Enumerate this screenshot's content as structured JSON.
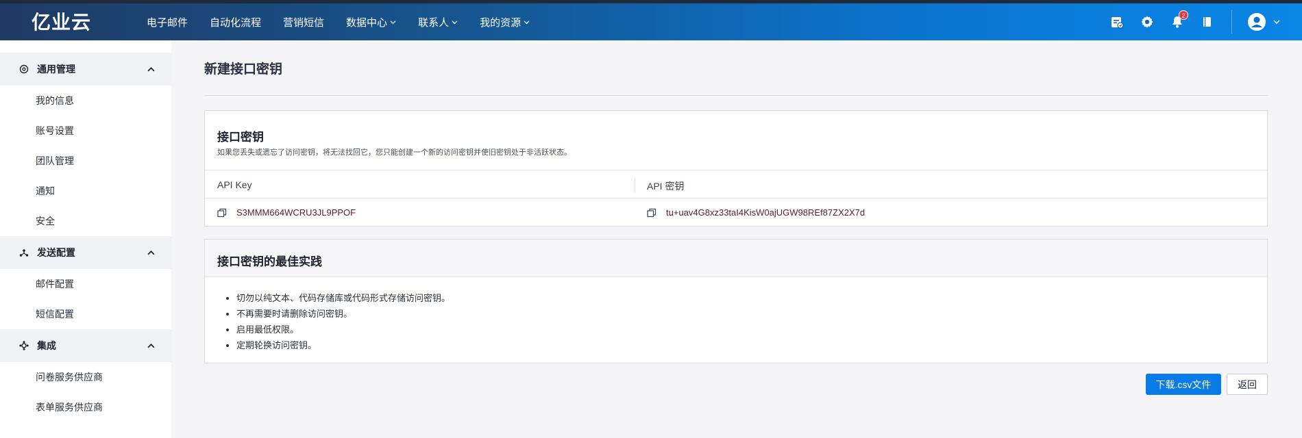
{
  "brand": {
    "logo_text": "亿业云"
  },
  "nav": [
    {
      "label": "电子邮件",
      "dropdown": false
    },
    {
      "label": "自动化流程",
      "dropdown": false
    },
    {
      "label": "营销短信",
      "dropdown": false
    },
    {
      "label": "数据中心",
      "dropdown": true
    },
    {
      "label": "联系人",
      "dropdown": true
    },
    {
      "label": "我的资源",
      "dropdown": true
    }
  ],
  "header_icons": {
    "billing": "billing-icon",
    "settings": "gear-icon",
    "notifications": "bell-icon",
    "notification_count": "2",
    "docs": "book-icon",
    "account": "user-avatar-icon"
  },
  "sidebar": {
    "sections": [
      {
        "title": "通用管理",
        "icon": "gear-circle-icon",
        "items": [
          "我的信息",
          "账号设置",
          "团队管理",
          "通知",
          "安全"
        ]
      },
      {
        "title": "发送配置",
        "icon": "share-nodes-icon",
        "items": [
          "邮件配置",
          "短信配置"
        ]
      },
      {
        "title": "集成",
        "icon": "puzzle-icon",
        "items": [
          "问卷服务供应商",
          "表单服务供应商"
        ]
      }
    ]
  },
  "page": {
    "title": "新建接口密钥",
    "keys_card": {
      "title": "接口密钥",
      "description": "如果您丢失或遗忘了访问密钥，将无法找回它，您只能创建一个新的访问密钥并使旧密钥处于非活跃状态。",
      "col_api_key": "API Key",
      "col_api_secret": "API 密钥",
      "api_key": "S3MMM664WCRU3JL9PPOF",
      "api_secret": "tu+uav4G8xz33taI4KisW0ajUGW98REf87ZX2X7d"
    },
    "best_practice": {
      "title": "接口密钥的最佳实践",
      "items": [
        "切勿以纯文本、代码存储库或代码形式存储访问密钥。",
        "不再需要时请删除访问密钥。",
        "启用最低权限。",
        "定期轮换访问密钥。"
      ]
    },
    "buttons": {
      "download": "下载.csv文件",
      "back": "返回"
    }
  },
  "colors": {
    "primary": "#0a7be6",
    "header_start": "#1f3a63",
    "header_end": "#0a86e6",
    "key_text": "#5a1e24"
  }
}
